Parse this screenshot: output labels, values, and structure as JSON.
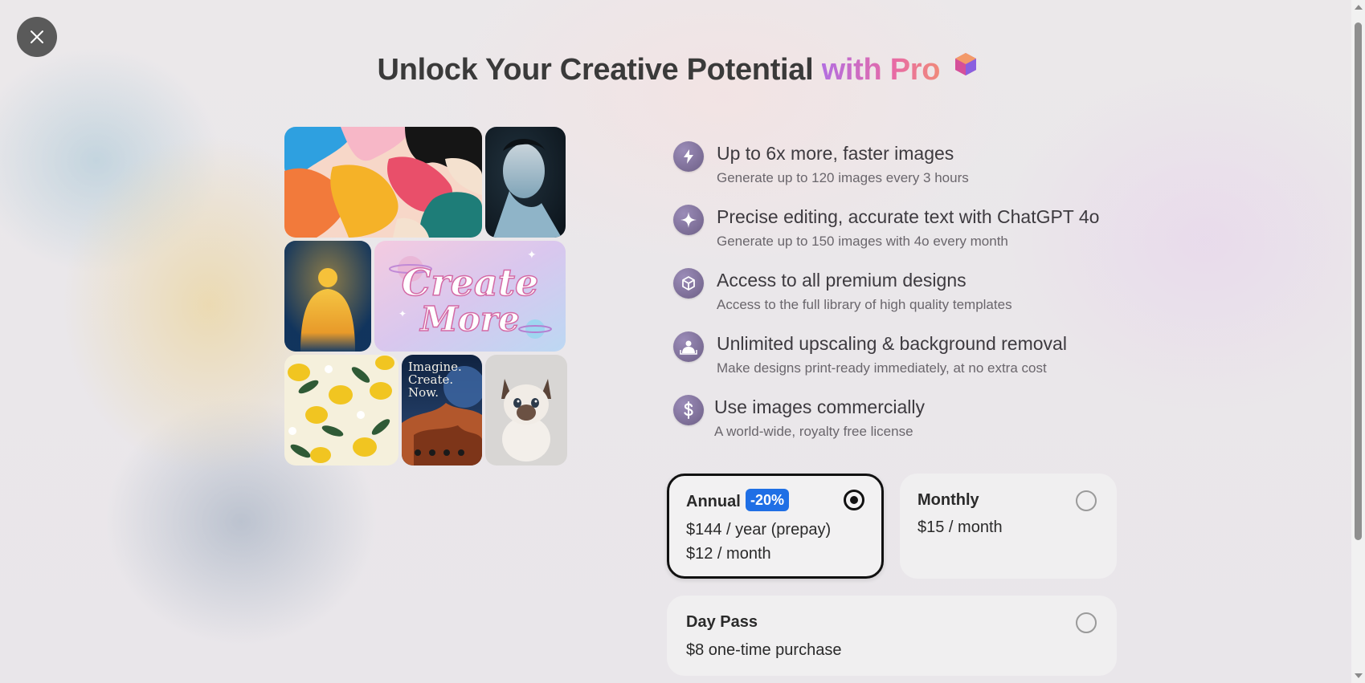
{
  "headline": {
    "main": "Unlock Your Creative Potential",
    "accent": "with Pro",
    "accent_gradient": [
      "#b36ee0",
      "#e76aa6",
      "#f08a7a"
    ]
  },
  "close_button": {
    "icon": "close-icon"
  },
  "collage": {
    "tiles": [
      {
        "name": "abstract-blobs-image"
      },
      {
        "name": "portrait-image"
      },
      {
        "name": "glowing-figure-image"
      },
      {
        "name": "create-more-lettering-image",
        "text": "Create More"
      },
      {
        "name": "lemons-pattern-image"
      },
      {
        "name": "imagine-poster-image",
        "text": "Imagine. Create. Now."
      },
      {
        "name": "kitten-image"
      }
    ]
  },
  "features": [
    {
      "icon": "lightning-icon",
      "title": "Up to 6x more, faster images",
      "description": "Generate up to 120 images every 3 hours"
    },
    {
      "icon": "sparkle-icon",
      "title": "Precise editing, accurate text with ChatGPT 4o",
      "description": "Generate up to 150 images with 4o every month"
    },
    {
      "icon": "box-icon",
      "title": "Access to all premium designs",
      "description": "Access to the full library of high quality templates"
    },
    {
      "icon": "person-image-icon",
      "title": "Unlimited upscaling & background removal",
      "description": "Make designs print-ready immediately, at no extra cost"
    },
    {
      "icon": "dollar-icon",
      "title": "Use images commercially",
      "description": "A world-wide, royalty free license"
    }
  ],
  "plans": {
    "annual": {
      "name": "Annual",
      "badge": "-20%",
      "line1": "$144 / year (prepay)",
      "line2": "$12 / month",
      "selected": true
    },
    "monthly": {
      "name": "Monthly",
      "line1": "$15 / month",
      "selected": false
    },
    "day_pass": {
      "name": "Day Pass",
      "line1": "$8 one-time purchase",
      "selected": false
    }
  },
  "colors": {
    "badge": "#1f6fe5",
    "icon_bg": "#7a6b93",
    "selected_border": "#111111"
  }
}
